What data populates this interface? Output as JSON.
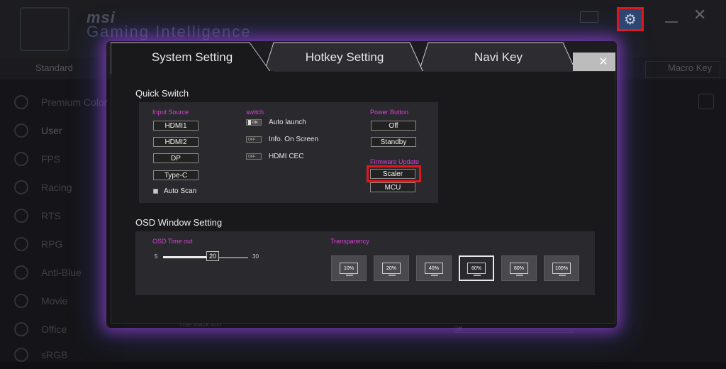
{
  "background": {
    "brand": "msi",
    "subbrand": "Gaming Intelligence",
    "tabs": [
      "Standard",
      "Macro Key"
    ],
    "sidebar": [
      "Premium Color",
      "User",
      "FPS",
      "Racing",
      "RTS",
      "RPG",
      "Anti-Blue",
      "Movie",
      "Office",
      "sRGB"
    ],
    "bottom_label": "True Black 400",
    "bottom_off": "Off"
  },
  "modal": {
    "tabs": {
      "system": "System Setting",
      "hotkey": "Hotkey Setting",
      "navi": "Navi Key"
    },
    "close": "×",
    "quick_switch": {
      "title": "Quick Switch",
      "input_source_label": "Input Source",
      "inputs": [
        "HDMI1",
        "HDMI2",
        "DP",
        "Type-C"
      ],
      "auto_scan": "Auto Scan",
      "switch_label": "switch",
      "switches": [
        {
          "label": "Auto launch",
          "state": "ON"
        },
        {
          "label": "Info. On Screen",
          "state": "OFF"
        },
        {
          "label": "HDMI CEC",
          "state": "OFF"
        }
      ],
      "power_label": "Power Button",
      "power": [
        "Off",
        "Standby"
      ],
      "firmware_label": "Firmware Update",
      "firmware": [
        "Scaler",
        "MCU"
      ]
    },
    "osd": {
      "title": "OSD Window Setting",
      "timeout_label": "OSD Time out",
      "timeout_min": "5",
      "timeout_max": "30",
      "timeout_value": "20",
      "transparency_label": "Transparency",
      "transparency": [
        "10%",
        "20%",
        "40%",
        "60%",
        "80%",
        "100%"
      ],
      "transparency_selected": "60%"
    }
  },
  "colors": {
    "accent_pink": "#d83fd6",
    "highlight_red": "#e0181b",
    "gear_blue": "#2e4670"
  },
  "icons": {
    "settings": "gear-icon"
  }
}
